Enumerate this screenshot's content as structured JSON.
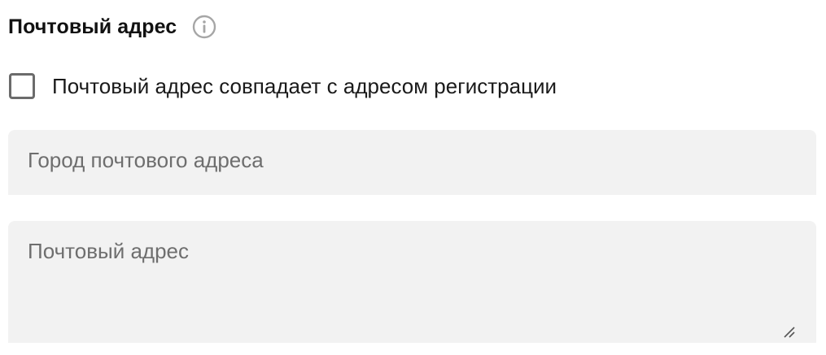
{
  "section": {
    "title": "Почтовый адрес",
    "info_icon": "info-circle-icon"
  },
  "same_address_checkbox": {
    "label": "Почтовый адрес совпадает с адресом регистрации",
    "checked": false
  },
  "city_field": {
    "placeholder": "Город почтового адреса",
    "value": ""
  },
  "address_field": {
    "placeholder": "Почтовый адрес",
    "value": ""
  },
  "colors": {
    "field_background": "#f2f2f2",
    "placeholder_text": "#6e6e6e",
    "checkbox_border": "#6b6b6b",
    "info_icon": "#a6a6a6"
  }
}
